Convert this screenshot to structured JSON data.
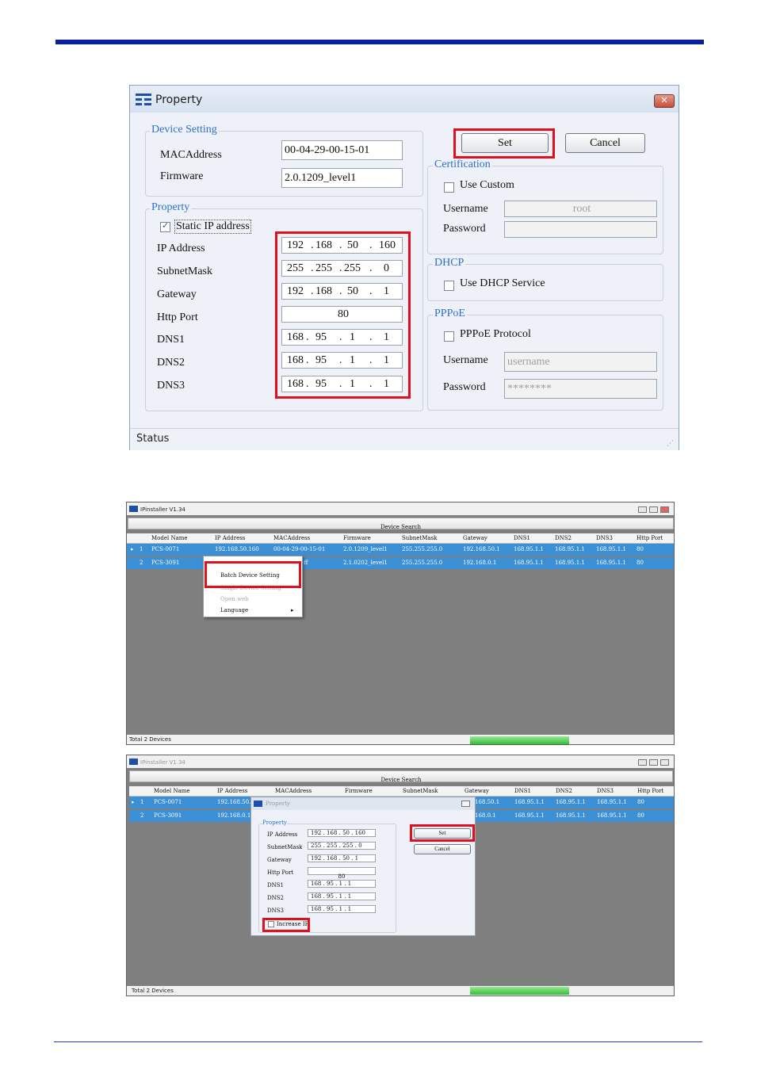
{
  "property_dialog": {
    "title": "Property",
    "device_setting": {
      "legend": "Device Setting",
      "mac_label": "MACAddress",
      "mac_value": "00-04-29-00-15-01",
      "firmware_label": "Firmware",
      "firmware_value": "2.0.1209_level1"
    },
    "property": {
      "legend": "Property",
      "static_ip_label": "Static IP address",
      "ip_label": "IP Address",
      "ip": [
        "192",
        "168",
        "50",
        "160"
      ],
      "subnet_label": "SubnetMask",
      "subnet": [
        "255",
        "255",
        "255",
        "0"
      ],
      "gateway_label": "Gateway",
      "gateway": [
        "192",
        "168",
        "50",
        "1"
      ],
      "http_label": "Http Port",
      "http_value": "80",
      "dns1_label": "DNS1",
      "dns1": [
        "168",
        "95",
        "1",
        "1"
      ],
      "dns2_label": "DNS2",
      "dns2": [
        "168",
        "95",
        "1",
        "1"
      ],
      "dns3_label": "DNS3",
      "dns3": [
        "168",
        "95",
        "1",
        "1"
      ]
    },
    "buttons": {
      "set": "Set",
      "cancel": "Cancel"
    },
    "certification": {
      "legend": "Certification",
      "use_custom": "Use Custom",
      "username_label": "Username",
      "username_value": "root",
      "password_label": "Password"
    },
    "dhcp": {
      "legend": "DHCP",
      "use_dhcp": "Use DHCP Service"
    },
    "pppoe": {
      "legend": "PPPoE",
      "protocol": "PPPoE Protocol",
      "username_label": "Username",
      "username_placeholder": "username",
      "password_label": "Password",
      "password_value": "********"
    },
    "status": "Status"
  },
  "ipinstaller_1": {
    "title": "IPinstaller V1.34",
    "device_search": "Device Search",
    "columns": [
      "Model Name",
      "IP Address",
      "MACAddress",
      "Firmware",
      "SubnetMask",
      "Gateway",
      "DNS1",
      "DNS2",
      "DNS3",
      "Http Port"
    ],
    "rows": [
      {
        "num": "1",
        "model": "PCS-0071",
        "ip": "192.168.50.160",
        "mac": "00-04-29-00-15-01",
        "fw": "2.0.1209_level1",
        "mask": "255.255.255.0",
        "gw": "192.168.50.1",
        "dns1": "168.95.1.1",
        "dns2": "168.95.1.1",
        "dns3": "168.95.1.1",
        "port": "80"
      },
      {
        "num": "2",
        "model": "PCS-3091",
        "ip": "",
        "mac": "-3e-ff",
        "fw": "2.1.0202_level1",
        "mask": "255.255.255.0",
        "gw": "192.168.0.1",
        "dns1": "168.95.1.1",
        "dns2": "168.95.1.1",
        "dns3": "168.95.1.1",
        "port": "80"
      }
    ],
    "menu": [
      "Batch Device Setting",
      "Single Device Setting",
      "Open web",
      "Language"
    ],
    "footer": "Total 2 Devices"
  },
  "ipinstaller_2": {
    "title": "IPinstaller V1.34",
    "device_search": "Device Search",
    "columns": [
      "Model Name",
      "IP Address",
      "MACAddress",
      "Firmware",
      "SubnetMask",
      "Gateway",
      "DNS1",
      "DNS2",
      "DNS3",
      "Http Port"
    ],
    "rows": [
      {
        "num": "1",
        "model": "PCS-0071",
        "ip": "192.168.50.1",
        "gw": "168.50.1",
        "dns1": "168.95.1.1",
        "dns2": "168.95.1.1",
        "dns3": "168.95.1.1",
        "port": "80"
      },
      {
        "num": "2",
        "model": "PCS-3091",
        "ip": "192.168.0.15",
        "gw": "168.0.1",
        "dns1": "168.95.1.1",
        "dns2": "168.95.1.1",
        "dns3": "168.95.1.1",
        "port": "80"
      }
    ],
    "popup": {
      "title": "Property",
      "legend": "Property",
      "labels": [
        "IP Address",
        "SubnetMask",
        "Gateway",
        "Http Port",
        "DNS1",
        "DNS2",
        "DNS3"
      ],
      "values": [
        "192 . 168 . 50 . 160",
        "255 . 255 . 255 . 0",
        "192 . 168 . 50 . 1",
        "80",
        "168 . 95 . 1 . 1",
        "168 . 95 . 1 . 1",
        "168 . 95 . 1 . 1"
      ],
      "increase_ip": "Increase IP",
      "set": "Set",
      "cancel": "Cancel"
    },
    "footer": "Total 2 Devices"
  },
  "colors": {
    "accent_blue": "#0a1f9e",
    "highlight_red": "#e0101c",
    "row_select": "#3b8fd4"
  }
}
